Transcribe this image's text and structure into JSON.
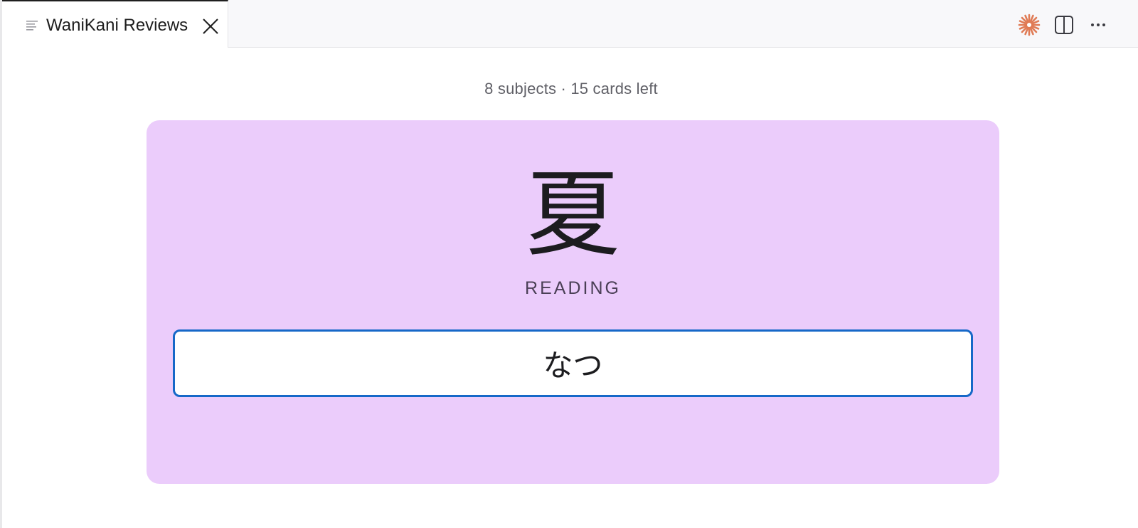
{
  "tab": {
    "title": "WaniKani Reviews",
    "icon": "list-icon",
    "close_icon": "close-icon"
  },
  "actions": {
    "items": [
      {
        "icon": "sparkle-icon",
        "color": "#e07b55"
      },
      {
        "icon": "split-editor-icon"
      },
      {
        "icon": "more-icon"
      }
    ]
  },
  "review": {
    "progress_text": "8 subjects · 15 cards left",
    "subject": "夏",
    "prompt": "READING",
    "answer_value": "なつ",
    "card_color": "#ebccfb",
    "input_border_color": "#1668c8"
  }
}
